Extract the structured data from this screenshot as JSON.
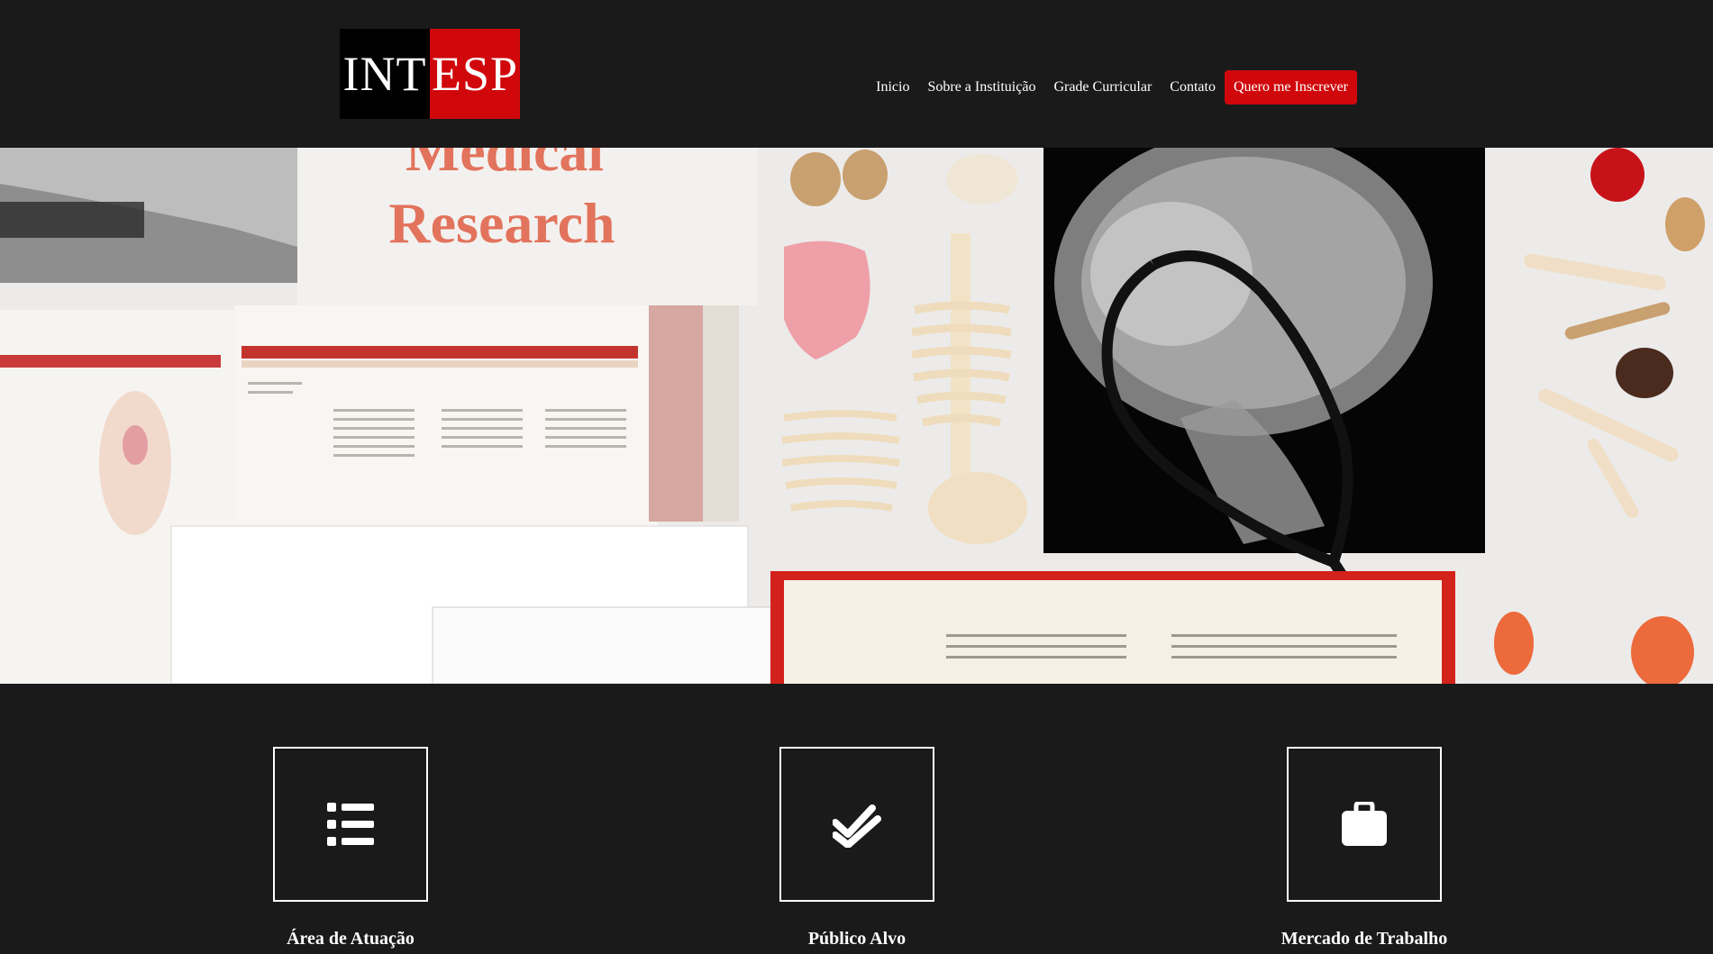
{
  "header": {
    "logo": {
      "left_text": "INT",
      "right_text": "ESP"
    },
    "nav": {
      "items": [
        "Inicio",
        "Sobre a Instituição",
        "Grade Curricular",
        "Contato"
      ],
      "cta_label": "Quero me Inscrever"
    }
  },
  "hero": {
    "image_text_line1": "Medical",
    "image_text_line2": "Research"
  },
  "features": [
    {
      "icon": "list-icon",
      "title": "Área de Atuação"
    },
    {
      "icon": "double-check-icon",
      "title": "Público Alvo"
    },
    {
      "icon": "briefcase-icon",
      "title": "Mercado de Trabalho"
    }
  ],
  "colors": {
    "background": "#1b1a1b",
    "accent": "#d0080c"
  }
}
